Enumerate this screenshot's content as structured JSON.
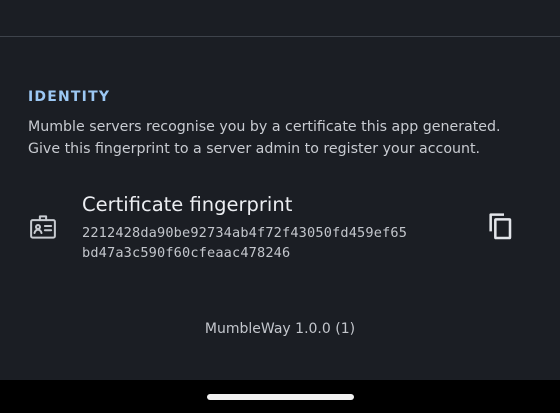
{
  "identity": {
    "header": "IDENTITY",
    "description": [
      "Mumble servers recognise you by a certificate this app generated.",
      "Give this fingerprint to a server admin to register your account."
    ],
    "certificate": {
      "title": "Certificate fingerprint",
      "fingerprint": [
        "2212428da90be92734ab4f72f43050fd459ef65",
        "bd47a3c590f60cfeaac478246"
      ],
      "icon": "badge-icon",
      "action_icon": "copy-icon"
    }
  },
  "footer": {
    "version": "MumbleWay 1.0.0 (1)"
  },
  "colors": {
    "background": "#1b1e24",
    "accent": "#9cc8f4",
    "divider": "#3e434b"
  }
}
